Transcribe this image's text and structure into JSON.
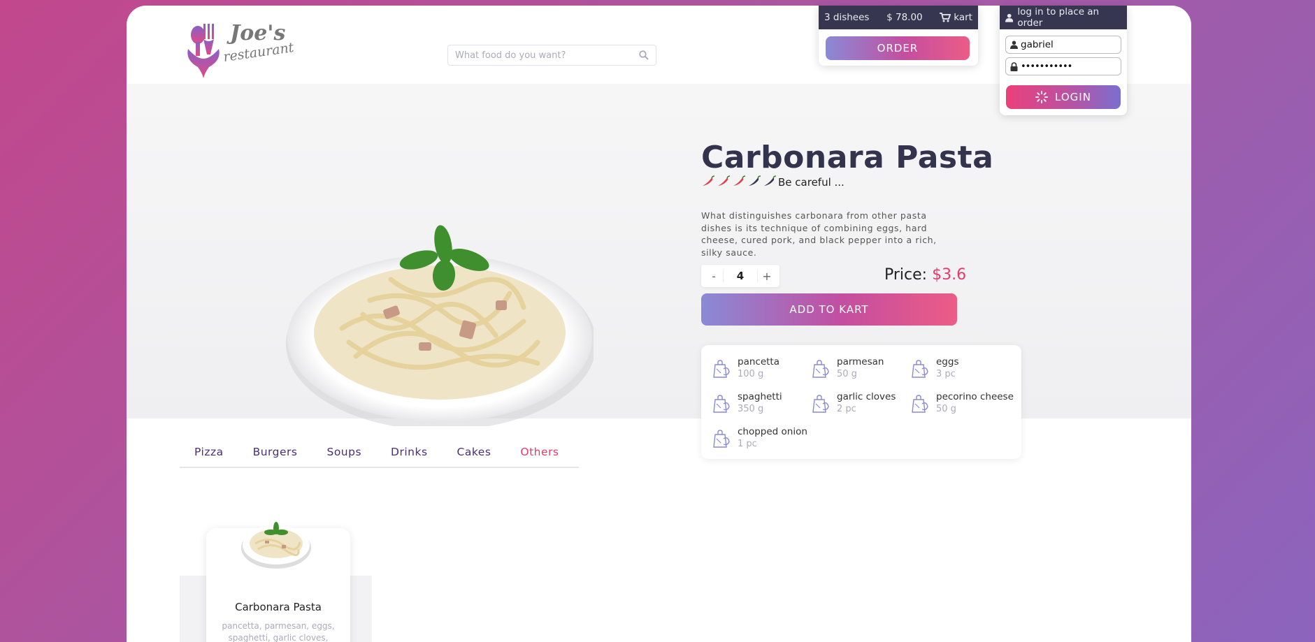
{
  "brand": {
    "name_line1": "Joe's",
    "name_line2": "restaurant"
  },
  "search": {
    "placeholder": "What food do you want?"
  },
  "cart": {
    "count": "3 dishees",
    "total": "$ 78.00",
    "kart_label": "kart",
    "order_label": "ORDER"
  },
  "login": {
    "prompt": "log in to place an order",
    "username": "gabriel",
    "password": "•••••••••••",
    "button_label": "LOGIN"
  },
  "product": {
    "title": "Carbonara Pasta",
    "spiciness": {
      "level": 3,
      "max": 5,
      "label": "Be careful ..."
    },
    "description": "What distinguishes carbonara from other pasta dishes is its technique of combining eggs, hard cheese, cured pork, and black pepper into a rich, silky sauce.",
    "quantity": "4",
    "qty_minus": "-",
    "qty_plus": "+",
    "price_label": "Price:",
    "price_value": "$3.6",
    "add_label": "ADD TO KART",
    "ingredients": [
      {
        "name": "pancetta",
        "amount": "100 g"
      },
      {
        "name": "parmesan",
        "amount": "50 g"
      },
      {
        "name": "eggs",
        "amount": "3 pc"
      },
      {
        "name": "spaghetti",
        "amount": "350 g"
      },
      {
        "name": "garlic cloves",
        "amount": "2 pc"
      },
      {
        "name": "pecorino cheese",
        "amount": "50 g"
      },
      {
        "name": "chopped onion",
        "amount": "1 pc"
      }
    ]
  },
  "tabs": [
    {
      "label": "Pizza"
    },
    {
      "label": "Burgers"
    },
    {
      "label": "Soups"
    },
    {
      "label": "Drinks"
    },
    {
      "label": "Cakes"
    },
    {
      "label": "Others"
    }
  ],
  "active_tab": "Others",
  "menu_card": {
    "name": "Carbonara Pasta",
    "description": "pancetta, parmesan, eggs, spaghetti, garlic cloves, pecorino"
  },
  "colors": {
    "accent": "#e53b6b",
    "dark": "#363650",
    "tab": "#4a2d7a"
  }
}
